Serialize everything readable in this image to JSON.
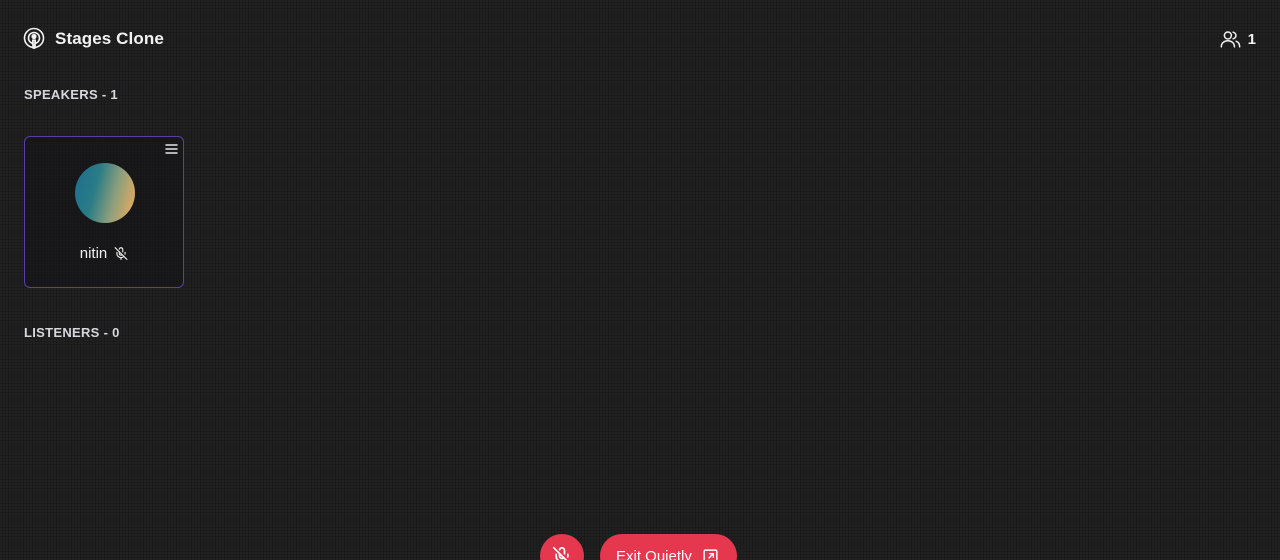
{
  "app": {
    "title": "Stages Clone",
    "logo_icon": "podcast-icon"
  },
  "header": {
    "participants_icon": "users-icon",
    "participants_count": "1"
  },
  "speakers": {
    "heading": "SPEAKERS - 1",
    "items": [
      {
        "name": "nitin",
        "muted": true,
        "mic_status_icon": "mic-off-icon",
        "menu_icon": "menu-icon"
      }
    ]
  },
  "listeners": {
    "heading": "LISTENERS - 0",
    "items": []
  },
  "controls": {
    "mic_icon": "mic-off-icon",
    "exit_label": "Exit Quietly",
    "exit_icon": "exit-icon"
  },
  "colors": {
    "background": "#1b1b1c",
    "card_border": "#5b3fa0",
    "danger": "#e5384f",
    "text": "#f2f2f2"
  }
}
